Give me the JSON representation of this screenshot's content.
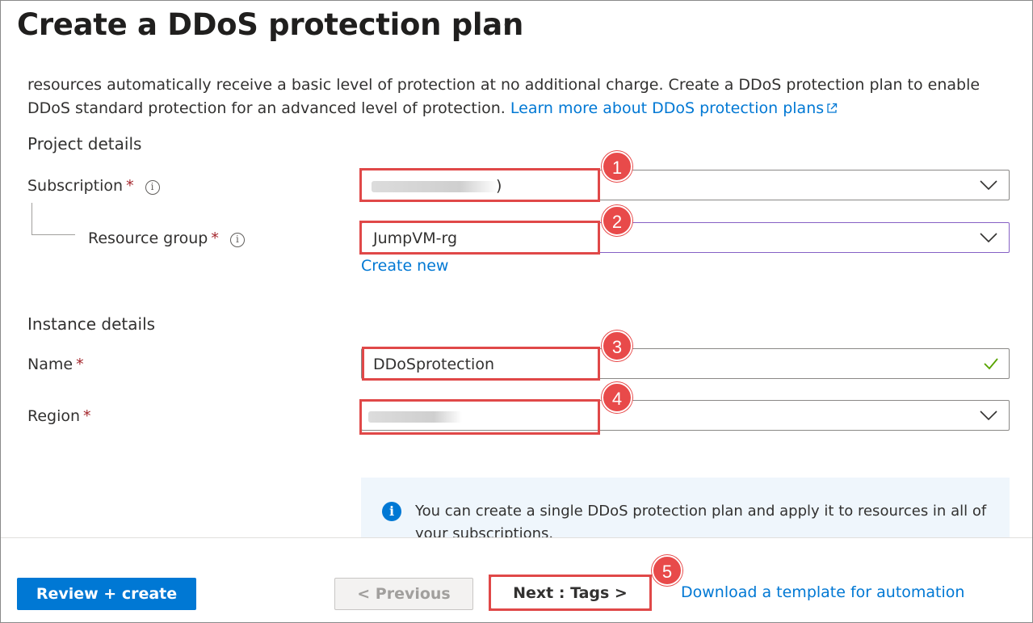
{
  "page": {
    "title": "Create a DDoS protection plan",
    "more_label": "···"
  },
  "intro": {
    "text_line1": "resources automatically receive a basic level of protection at no additional charge. Create a DDoS protection plan to enable",
    "text_line2": "DDoS standard protection for an advanced level of protection. ",
    "link_label": "Learn more about DDoS protection plans"
  },
  "project": {
    "heading": "Project details",
    "subscription_label": "Subscription",
    "subscription_value": ")",
    "resource_group_label": "Resource group",
    "resource_group_value": "JumpVM-rg",
    "create_new_label": "Create new"
  },
  "instance": {
    "heading": "Instance details",
    "name_label": "Name",
    "name_value": "DDoSprotection",
    "region_label": "Region"
  },
  "required_marker": "*",
  "info_glyph": "i",
  "infobox": {
    "icon": "i",
    "message": "You can create a single DDoS protection plan and apply it to resources in all of your subscriptions."
  },
  "footer": {
    "review_create_label": "Review + create",
    "previous_label": "< Previous",
    "next_label": "Next : Tags >",
    "download_label": "Download a template for automation"
  },
  "annotations": {
    "badge_1": "1",
    "badge_2": "2",
    "badge_3": "3",
    "badge_4": "4",
    "badge_5": "5"
  },
  "colors": {
    "accent": "#0078d4",
    "required": "#a4262c",
    "annotation": "#e04848",
    "valid_check": "#57a300"
  }
}
